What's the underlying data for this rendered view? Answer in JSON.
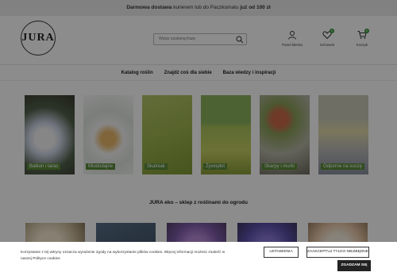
{
  "promo": {
    "part1": "Darmowa dostawa",
    "part2": " kurierem lub do Paczkomatu ",
    "part3": "już od 100 zł"
  },
  "logo": {
    "text": "JURA"
  },
  "search": {
    "placeholder": "Wpisz szukaną frazę"
  },
  "actions": [
    {
      "label": "Panel klienta",
      "icon": "user-icon"
    },
    {
      "label": "Schowek",
      "icon": "heart-icon",
      "badge": "0"
    },
    {
      "label": "Koszyk",
      "icon": "cart-icon",
      "badge": "0"
    }
  ],
  "nav": [
    "Katalog roślin",
    "Znajdź coś dla siebie",
    "Baza wiedzy i inspiracji"
  ],
  "categories": [
    "Balkon i taras",
    "Miododajne",
    "Skalniak",
    "Żywopłot",
    "Skarpy i murki",
    "Odporne na suszę"
  ],
  "section_title": "JURA eko – sklep z roślinami do ogrodu",
  "cookie": {
    "text": "Korzystanie z tej witryny oznacza wyrażenie zgody na wykorzystanie plików cookies. Więcej informacji możesz znaleźć w naszej Polityce cookies",
    "settings": "USTAWIENIA",
    "reject": "ZAAKCEPTUJ TYLKO NIEZBĘDNE",
    "accept": "ZGADZAM SIĘ"
  },
  "colors": {
    "accent": "#5a8a3a",
    "badge": "#3b9a3b"
  }
}
